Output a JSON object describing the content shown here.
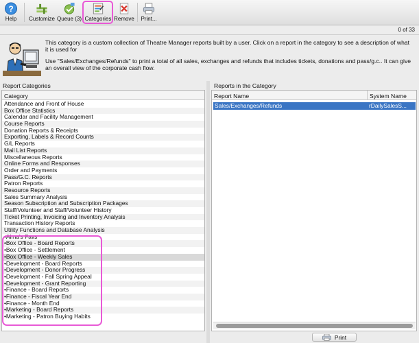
{
  "toolbar": {
    "help": "Help",
    "customize": "Customize",
    "queue": "Queue (3)",
    "categories": "Categories",
    "remove": "Remove",
    "print": "Print..."
  },
  "counter": "0 of 33",
  "description": {
    "line1": "This category is a custom collection of Theatre Manager reports built by a user.  Click on a report in the category to see a description of what it is used for",
    "line2": "Use \"Sales/Exchanges/Refunds\" to print a total of all sales, exchanges and refunds that includes tickets, donations and pass/g.c..  It can give an overall view of the corporate cash flow."
  },
  "left_panel": {
    "title": "Report Categories",
    "column": "Category",
    "items": [
      "Attendance and Front of House",
      "Box Office Statistics",
      "Calendar and Facility Management",
      "Course Reports",
      "Donation Reports & Receipts",
      "Exporting, Labels & Record Counts",
      "G/L Reports",
      "Mail List Reports",
      "Miscellaneous Reports",
      "Online Forms and Responses",
      "Order and Payments",
      "Pass/G.C. Reports",
      "Patron Reports",
      "Resource Reports",
      "Sales Summary Analysis",
      "Season Subscription and Subscription Packages",
      "Staff/Volunteer and Staff/Volunteer History",
      "Ticket Printing, Invoicing and Inventory Analysis",
      "Transaction History Reports",
      "Utility Functions and Database Analysis",
      "•Alma's Favs",
      "•Box Office - Board Reports",
      "•Box Office - Settlement",
      "•Box Office - Weekly Sales",
      "•Development - Board Reports",
      "•Development - Donor Progress",
      "•Development - Fall Spring Appeal",
      "•Development - Grant Reporting",
      "•Finance - Board Reports",
      "•Finance - Fiscal Year End",
      "•Finance - Month End",
      "•Marketing - Board Reports",
      "•Marketing - Patron Buying Habits"
    ]
  },
  "right_panel": {
    "title": "Reports in the Category",
    "col_name": "Report Name",
    "col_system": "System Name",
    "rows": [
      {
        "name": "Sales/Exchanges/Refunds",
        "system": "rDailySalesS..."
      }
    ]
  },
  "print_button": "Print",
  "colors": {
    "highlight": "#e85ad6",
    "selection": "#3a75c4"
  }
}
